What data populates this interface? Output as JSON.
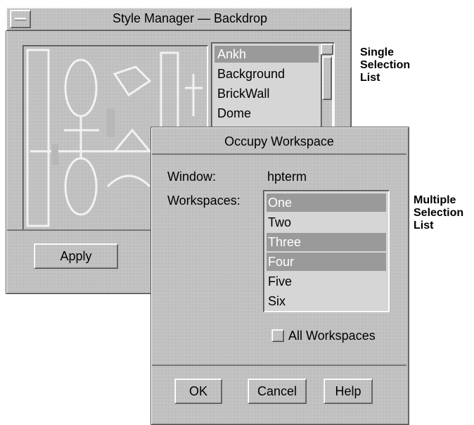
{
  "style_manager": {
    "title": "Style Manager — Backdrop",
    "backdrops": [
      "Ankh",
      "Background",
      "BrickWall",
      "Dome"
    ],
    "selected_index": 0,
    "apply_label": "Apply"
  },
  "annotations": {
    "single": [
      "Single",
      "Selection",
      "List"
    ],
    "multiple": [
      "Multiple",
      "Selection",
      "List"
    ]
  },
  "occupy_workspace": {
    "title": "Occupy Workspace",
    "window_label": "Window:",
    "window_value": "hpterm",
    "workspaces_label": "Workspaces:",
    "workspaces": [
      {
        "label": "One",
        "selected": true
      },
      {
        "label": "Two",
        "selected": false
      },
      {
        "label": "Three",
        "selected": true
      },
      {
        "label": "Four",
        "selected": true
      },
      {
        "label": "Five",
        "selected": false
      },
      {
        "label": "Six",
        "selected": false
      }
    ],
    "all_workspaces_label": "All Workspaces",
    "all_workspaces_checked": false,
    "buttons": {
      "ok": "OK",
      "cancel": "Cancel",
      "help": "Help"
    }
  }
}
